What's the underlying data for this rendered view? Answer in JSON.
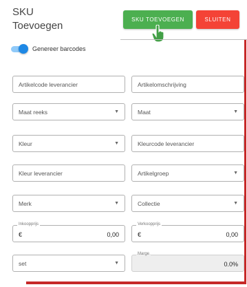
{
  "header": {
    "title_line1": "SKU",
    "title_line2": "Toevoegen",
    "add_label": "SKU TOEVOEGEN",
    "close_label": "SLUITEN"
  },
  "toggle": {
    "label": "Genereer barcodes",
    "checked": true
  },
  "fields": {
    "artikelcode_leverancier": "Artikelcode leverancier",
    "artikelomschrijving": "Artikelomschrijving",
    "maat_reeks": "Maat reeks",
    "maat": "Maat",
    "kleur": "Kleur",
    "kleurcode_leverancier": "Kleurcode leverancier",
    "kleur_leverancier": "Kleur leverancier",
    "artikelgroep": "Artikelgroep",
    "merk": "Merk",
    "collectie": "Collectie",
    "inkoopprijs": {
      "label": "Inkoopprijs",
      "prefix": "€",
      "value": "0,00"
    },
    "verkoopprijs": {
      "label": "Verkoopprijs",
      "prefix": "€",
      "value": "0,00"
    },
    "set": "set",
    "marge": {
      "label": "Marge",
      "value": "0.0%"
    }
  },
  "icons": {
    "dropdown": "caret-down-icon",
    "cursor": "pointer-hand-icon"
  },
  "colors": {
    "add": "#4caf50",
    "close": "#f44336",
    "accent": "#1e88e5",
    "border": "#c62828"
  }
}
